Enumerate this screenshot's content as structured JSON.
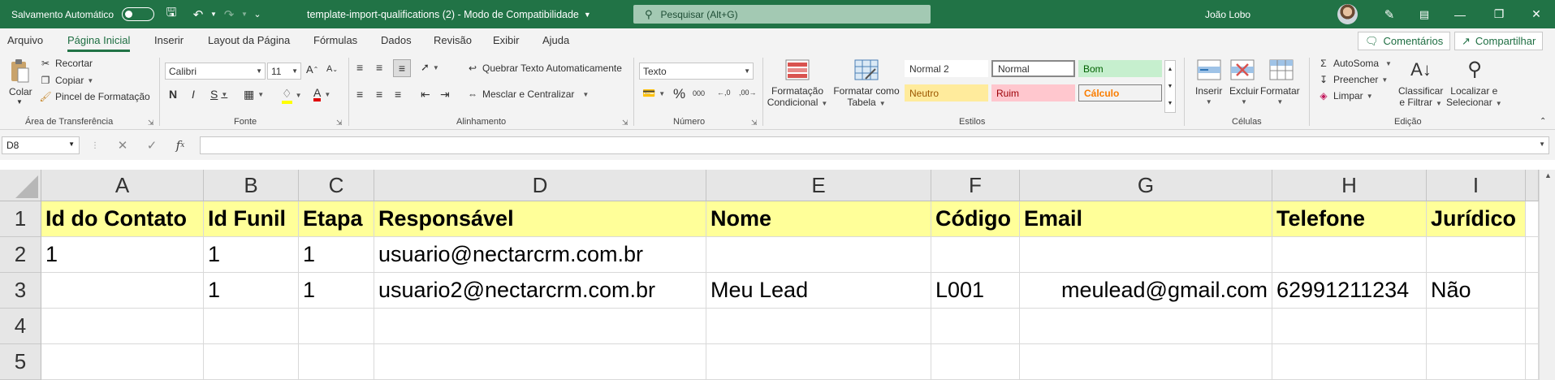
{
  "titlebar": {
    "autosave_label": "Salvamento Automático",
    "title": "template-import-qualifications (2)  -  Modo de Compatibilidade",
    "search_placeholder": "Pesquisar (Alt+G)",
    "user_name": "João Lobo"
  },
  "menu": {
    "tabs": [
      "Arquivo",
      "Página Inicial",
      "Inserir",
      "Layout da Página",
      "Fórmulas",
      "Dados",
      "Revisão",
      "Exibir",
      "Ajuda"
    ],
    "active_tab": "Página Inicial",
    "comments_label": "Comentários",
    "share_label": "Compartilhar"
  },
  "ribbon": {
    "clipboard": {
      "paste": "Colar",
      "cut": "Recortar",
      "copy": "Copiar",
      "format_painter": "Pincel de Formatação",
      "label": "Área de Transferência"
    },
    "font": {
      "font_name": "Calibri",
      "font_size": "11",
      "label": "Fonte"
    },
    "alignment": {
      "wrap_text": "Quebrar Texto Automaticamente",
      "merge_center": "Mesclar e Centralizar",
      "label": "Alinhamento"
    },
    "number": {
      "format": "Texto",
      "label": "Número"
    },
    "styles": {
      "conditional_formatting": [
        "Formatação",
        "Condicional"
      ],
      "format_as_table": [
        "Formatar como",
        "Tabela"
      ],
      "cells": [
        "Normal 2",
        "Normal",
        "Bom",
        "Neutro",
        "Ruim",
        "Cálculo"
      ],
      "label": "Estilos"
    },
    "cells": {
      "insert": "Inserir",
      "delete": "Excluir",
      "format": "Formatar",
      "label": "Células"
    },
    "editing": {
      "autosum": "AutoSoma",
      "fill": "Preencher",
      "clear": "Limpar",
      "sort_filter": [
        "Classificar",
        "e Filtrar"
      ],
      "find_select": [
        "Localizar e",
        "Selecionar"
      ],
      "label": "Edição"
    }
  },
  "formula_bar": {
    "name_box": "D8",
    "formula": ""
  },
  "sheet": {
    "columns": [
      "A",
      "B",
      "C",
      "D",
      "E",
      "F",
      "G",
      "H",
      "I"
    ],
    "rows": [
      [
        "Id do Contato",
        "Id Funil",
        "Etapa",
        "Responsável",
        "Nome",
        "Código",
        "Email",
        "Telefone",
        "Jurídico"
      ],
      [
        "1",
        "1",
        "1",
        "usuario@nectarcrm.com.br",
        "",
        "",
        "",
        "",
        ""
      ],
      [
        "",
        "1",
        "1",
        "usuario2@nectarcrm.com.br",
        "Meu Lead",
        "L001",
        "meulead@gmail.com",
        "62991211234",
        "Não"
      ],
      [
        "",
        "",
        "",
        "",
        "",
        "",
        "",
        "",
        ""
      ],
      [
        "",
        "",
        "",
        "",
        "",
        "",
        "",
        "",
        ""
      ]
    ],
    "row_numbers": [
      "1",
      "2",
      "3",
      "4",
      "5"
    ]
  }
}
